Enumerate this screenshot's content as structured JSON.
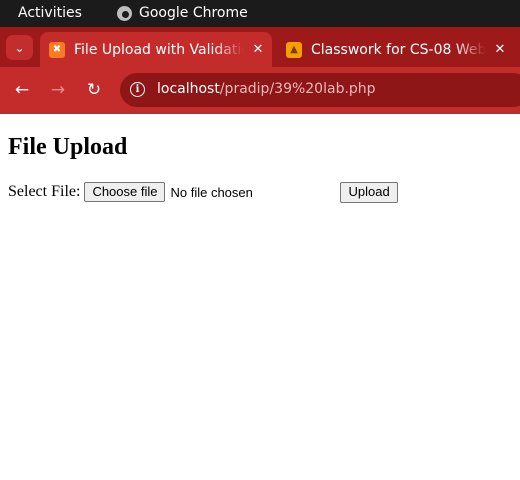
{
  "system_bar": {
    "activities": "Activities",
    "app_name": "Google Chrome"
  },
  "tabs": [
    {
      "title": "File Upload with Validation",
      "favicon": "xampp-icon",
      "active": true
    },
    {
      "title": "Classwork for CS-08 Web",
      "favicon": "google-classroom-icon",
      "active": false
    }
  ],
  "toolbar": {
    "url_host": "localhost",
    "url_path": "/pradip/39%20lab.php"
  },
  "page": {
    "heading": "File Upload",
    "select_label": "Select File:",
    "choose_file_label": "Choose file",
    "file_status": "No file chosen",
    "upload_label": "Upload"
  },
  "colors": {
    "tab_strip": "#9e1a1a",
    "active_tab": "#c42b2b",
    "omnibox": "#8f1616"
  }
}
